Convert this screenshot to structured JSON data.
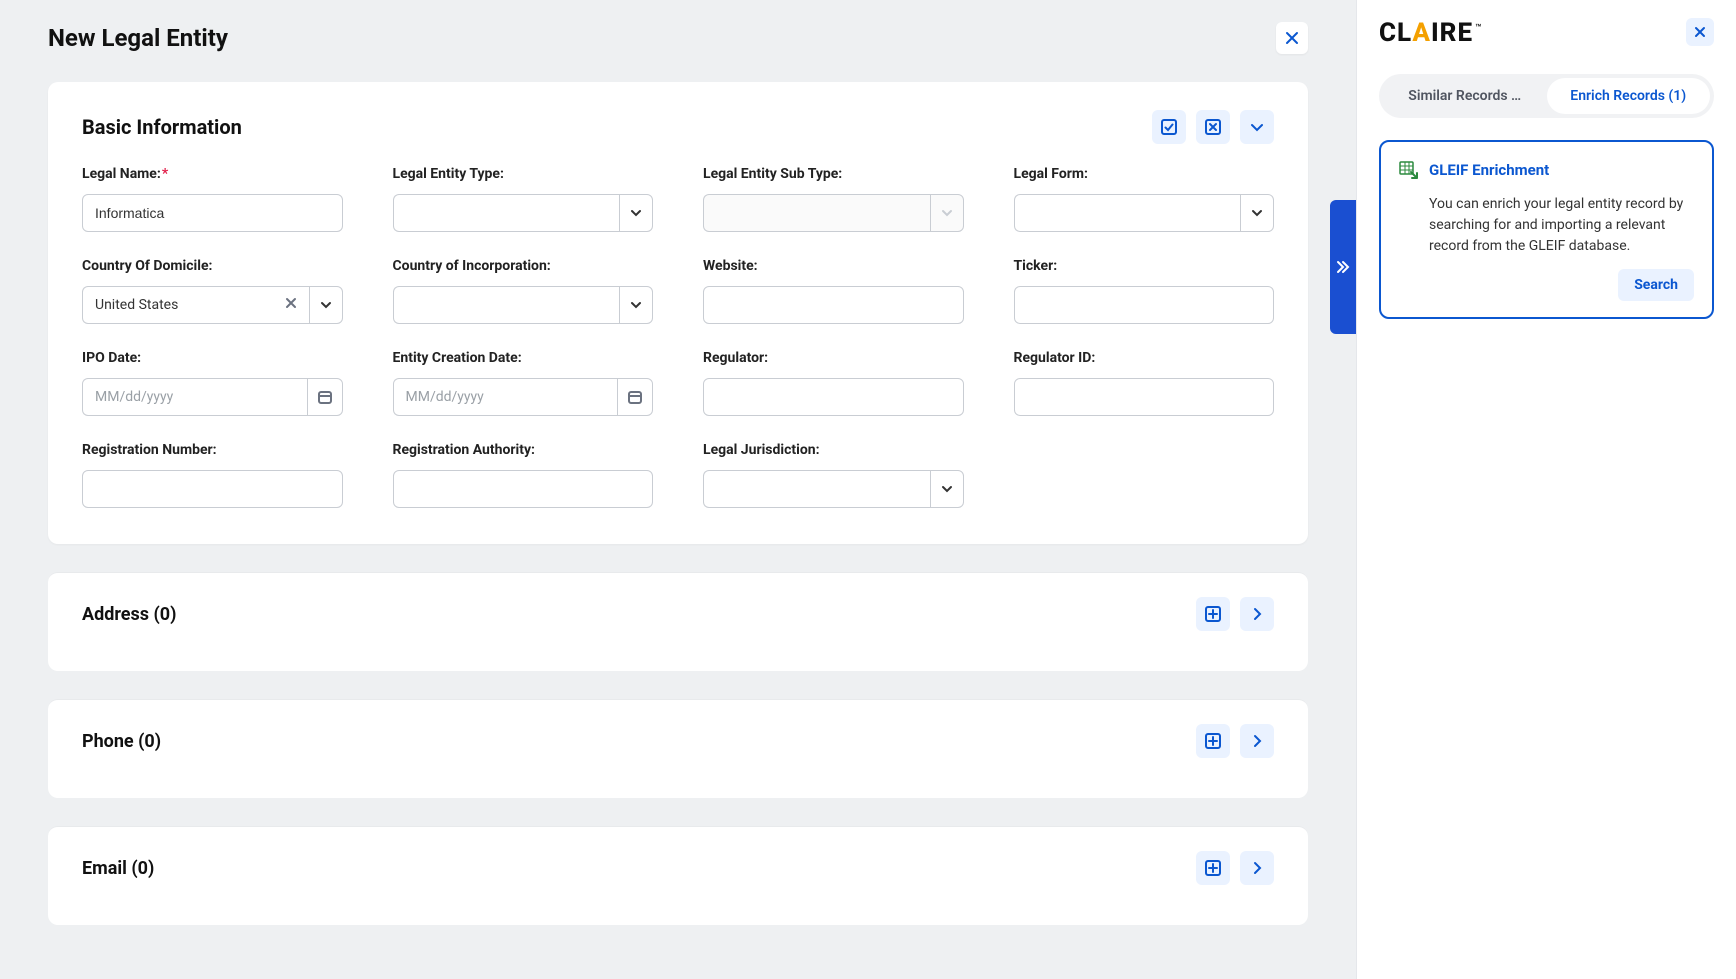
{
  "page": {
    "title": "New Legal Entity"
  },
  "sections": {
    "basic": {
      "title": "Basic Information",
      "fields": {
        "legalName": {
          "label": "Legal Name:",
          "value": "Informatica",
          "required": true
        },
        "legalEntityType": {
          "label": "Legal Entity Type:",
          "value": ""
        },
        "legalEntitySubType": {
          "label": "Legal Entity Sub Type:",
          "value": ""
        },
        "legalForm": {
          "label": "Legal Form:",
          "value": ""
        },
        "countryDomicile": {
          "label": "Country Of Domicile:",
          "value": "United States"
        },
        "countryIncorporation": {
          "label": "Country of Incorporation:",
          "value": ""
        },
        "website": {
          "label": "Website:",
          "value": ""
        },
        "ticker": {
          "label": "Ticker:",
          "value": ""
        },
        "ipoDate": {
          "label": "IPO Date:",
          "placeholder": "MM/dd/yyyy"
        },
        "entityCreationDate": {
          "label": "Entity Creation Date:",
          "placeholder": "MM/dd/yyyy"
        },
        "regulator": {
          "label": "Regulator:",
          "value": ""
        },
        "regulatorId": {
          "label": "Regulator ID:",
          "value": ""
        },
        "registrationNumber": {
          "label": "Registration Number:",
          "value": ""
        },
        "registrationAuthority": {
          "label": "Registration Authority:",
          "value": ""
        },
        "legalJurisdiction": {
          "label": "Legal Jurisdiction:",
          "value": ""
        }
      }
    },
    "address": {
      "title": "Address (0)"
    },
    "phone": {
      "title": "Phone (0)"
    },
    "email": {
      "title": "Email (0)"
    }
  },
  "sidebar": {
    "brand": {
      "c": "CL",
      "a": "A",
      "r": "IRE",
      "tm": "™"
    },
    "tabs": {
      "similar": "Similar Records …",
      "enrich": "Enrich Records (1)"
    },
    "card": {
      "title": "GLEIF Enrichment",
      "body": "You can enrich your legal entity record by searching for and importing a relevant record from the GLEIF database.",
      "action": "Search"
    }
  }
}
